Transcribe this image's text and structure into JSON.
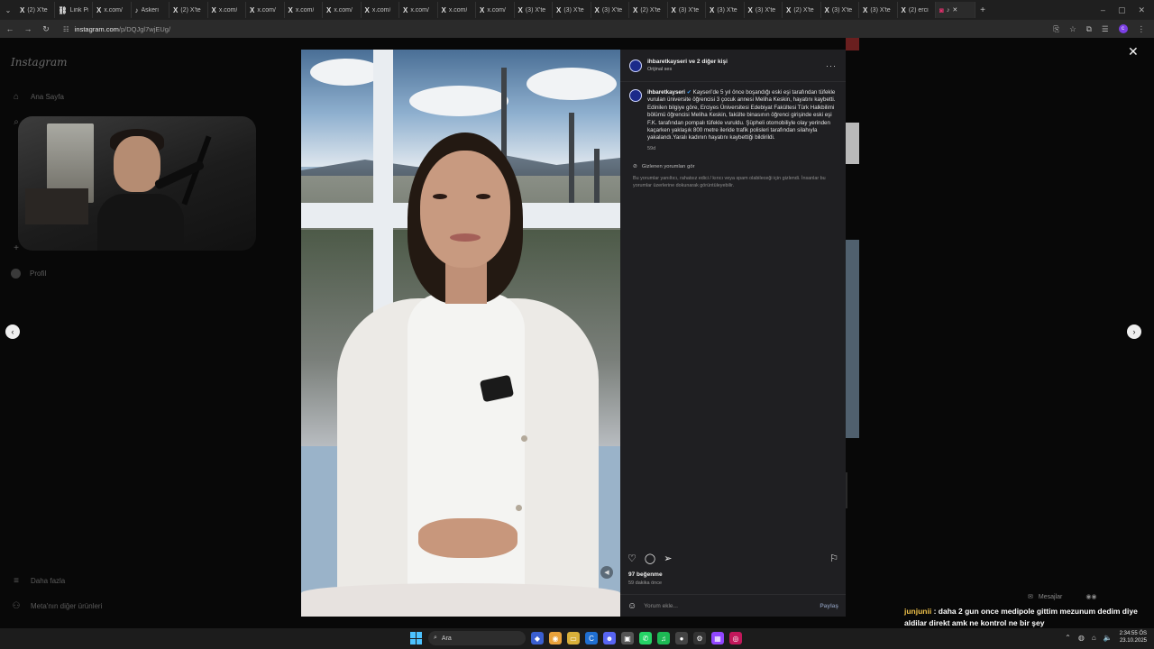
{
  "tabs": [
    {
      "icon": "x-icon",
      "label": "(2) X'te"
    },
    {
      "icon": "link-icon",
      "label": "Link Pi"
    },
    {
      "icon": "x-icon",
      "label": "x.com/"
    },
    {
      "icon": "tiktok-icon",
      "label": "Askeri"
    },
    {
      "icon": "x-icon",
      "label": "(2) X'te"
    },
    {
      "icon": "x-icon",
      "label": "x.com/"
    },
    {
      "icon": "x-icon",
      "label": "x.com/"
    },
    {
      "icon": "x-icon",
      "label": "x.com/"
    },
    {
      "icon": "x-icon",
      "label": "x.com/"
    },
    {
      "icon": "x-icon",
      "label": "x.com/"
    },
    {
      "icon": "x-icon",
      "label": "x.com/"
    },
    {
      "icon": "x-icon",
      "label": "x.com/"
    },
    {
      "icon": "x-icon",
      "label": "x.com/"
    },
    {
      "icon": "x-icon",
      "label": "(3) X'te"
    },
    {
      "icon": "x-icon",
      "label": "(3) X'te"
    },
    {
      "icon": "x-icon",
      "label": "(3) X'te"
    },
    {
      "icon": "x-icon",
      "label": "(2) X'te"
    },
    {
      "icon": "x-icon",
      "label": "(3) X'te"
    },
    {
      "icon": "x-icon",
      "label": "(3) X'te"
    },
    {
      "icon": "x-icon",
      "label": "(3) X'te"
    },
    {
      "icon": "x-icon",
      "label": "(2) X'te"
    },
    {
      "icon": "x-icon",
      "label": "(3) X'te"
    },
    {
      "icon": "x-icon",
      "label": "(3) X'te"
    },
    {
      "icon": "x-icon",
      "label": "(2) erci"
    }
  ],
  "address": {
    "domain": "instagram.com",
    "path": "/p/DQJgl7wjEUg/"
  },
  "sidebar": {
    "logo": "Instagram",
    "home": "Ana Sayfa",
    "profile": "Profil",
    "more": "Daha fazla",
    "meta": "Meta'nın diğer ürünleri"
  },
  "post": {
    "header_user": "ihbaretkayseri ve 2 diğer kişi",
    "header_audio": "Orijinal ses",
    "caption_user": "ihbaretkayseri",
    "caption_text": "Kayseri'de 5 yıl önce boşandığı eski eşi tarafından tüfekle vurulan üniversite öğrencisi 3 çocuk annesi Meliha Keskin, hayatını kaybetti. Edinilen bilgiye göre, Erciyes Üniversitesi Edebiyat Fakültesi Türk Halkbilimi bölümü öğrencisi Meliha Keskin, fakülte binasının öğrenci girişinde eski eşi F.K. tarafından pompalı tüfekle vuruldu. Şüpheli otomobiliyle olay yerinden kaçarken yaklaşık 800 metre ileride trafik polisleri tarafından silahıyla yakalandı.Yaralı kadının hayatını kaybettiği bildirildi.",
    "caption_time": "59d",
    "hidden_comments_label": "Gizlenen yorumları gör",
    "hidden_note": "Bu yorumlar yanıltıcı, rahatsız edici / kırıcı veya spam olabileceği için gizlendi. İnsanlar bu yorumlar üzerlerine dokunarak görüntüleyebilir.",
    "likes": "97 beğenme",
    "ago": "59 dakika önce",
    "comment_placeholder": "Yorum ekle...",
    "share_label": "Paylaş"
  },
  "overlay": {
    "messages_label": "Mesajlar",
    "chat_user": "junjunii",
    "chat_text": " daha 2 gun once medipole gittim mezunum dedim diye aldilar direkt amk ne kontrol ne bir şey"
  },
  "taskbar": {
    "search_placeholder": "Ara",
    "time": "2:34:55 ÖS",
    "date": "23.10.2025"
  },
  "colors": {
    "accent_instagram": "#e1306c",
    "verified": "#3897f0",
    "chat_user": "#f0c24a"
  }
}
